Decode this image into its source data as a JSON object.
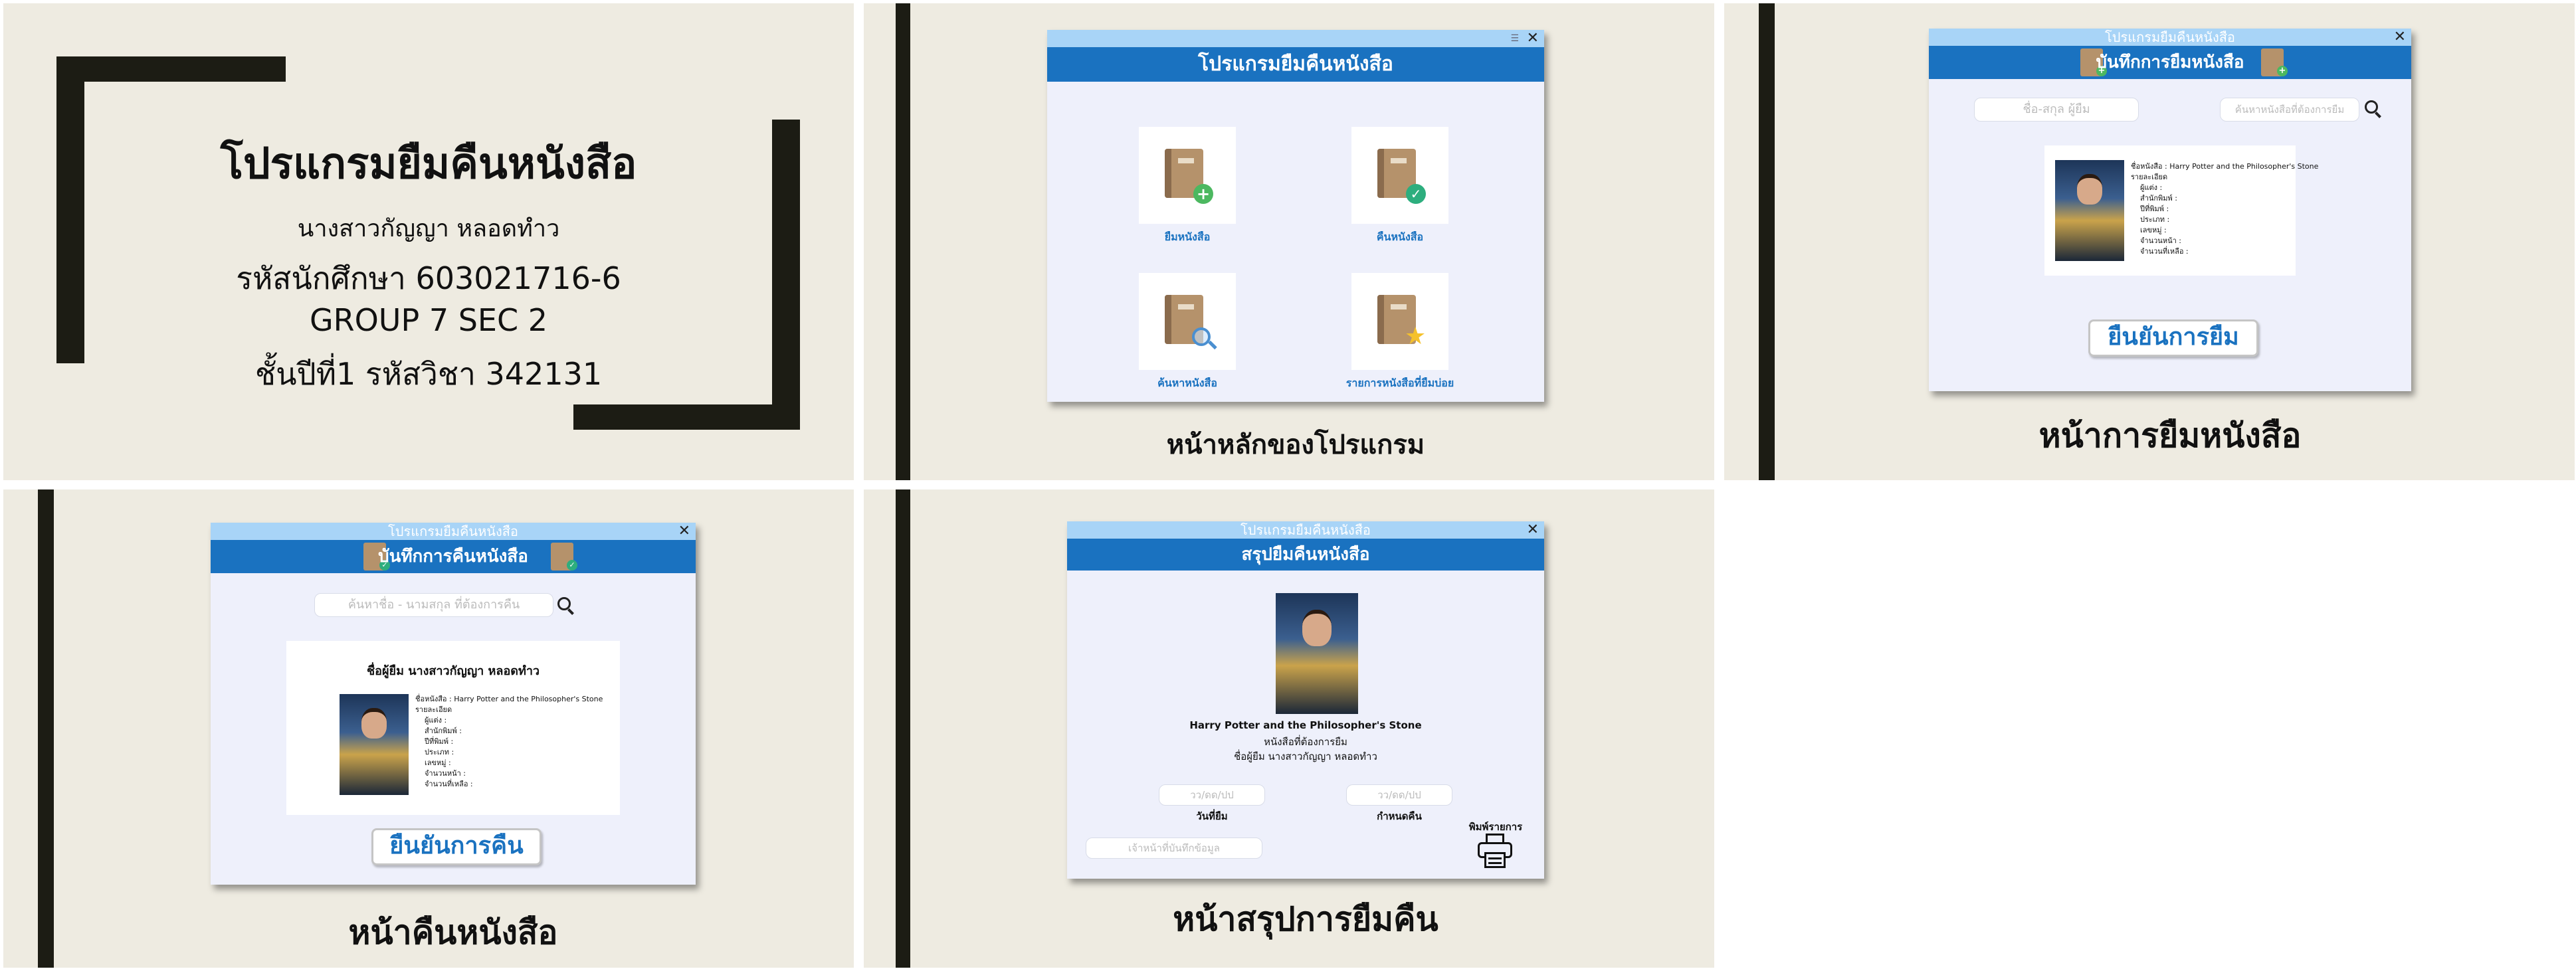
{
  "title_slide": {
    "title": "โปรแกรมยืมคืนหนังสือ",
    "name": "นางสาวกัญญา หลอดทำว",
    "student_id": "รหัสนักศึกษา 603021716-6",
    "group": "GROUP 7 SEC 2",
    "course": "ชั้นปีที่1 รหัสวิชา 342131"
  },
  "main_slide": {
    "window_title": "โปรแกรมยืมคืนหนังสือ",
    "tiles": [
      {
        "label": "ยืมหนังสือ",
        "icon": "book-add-icon"
      },
      {
        "label": "คืนหนังสือ",
        "icon": "book-check-icon"
      },
      {
        "label": "ค้นหาหนังสือ",
        "icon": "book-search-icon"
      },
      {
        "label": "รายการหนังสือที่ยืมบ่อย",
        "icon": "book-star-icon"
      }
    ],
    "caption": "หน้าหลักของโปรแกรม"
  },
  "borrow_slide": {
    "app_title": "โปรแกรมยืมคืนหนังสือ",
    "header": "บันทึกการยืมหนังสือ",
    "name_placeholder": "ชื่อ-สกุล ผู้ยืม",
    "search_placeholder": "ค้นหาหนังสือที่ต้องการยืม",
    "book_info": "ชื่อหนังสือ : Harry Potter and the Philosopher's Stone\nรายละเอียด\n    ผู้แต่ง :\n    สำนักพิมพ์ :\n    ปีที่พิมพ์ :\n    ประเภท :\n    เลขหมู่ :\n    จำนวนหน้า :\n    จำนวนที่เหลือ :",
    "confirm_button": "ยืนยันการยืม",
    "caption": "หน้าการยืมหนังสือ"
  },
  "return_slide": {
    "app_title": "โปรแกรมยืมคืนหนังสือ",
    "header": "บันทึกการคืนหนังสือ",
    "search_placeholder": "ค้นหาชื่อ - นามสกุล ที่ต้องการคืน",
    "borrower": "ชื่อผู้ยืม นางสาวกัญญา หลอดทำว",
    "book_info": "ชื่อหนังสือ : Harry Potter and the Philosopher's Stone\nรายละเอียด\n    ผู้แต่ง :\n    สำนักพิมพ์ :\n    ปีที่พิมพ์ :\n    ประเภท :\n    เลขหมู่ :\n    จำนวนหน้า :\n    จำนวนที่เหลือ :",
    "confirm_button": "ยืนยันการคืน",
    "caption": "หน้าคืนหนังสือ"
  },
  "summary_slide": {
    "app_title": "โปรแกรมยืมคืนหนังสือ",
    "header": "สรุปยืมคืนหนังสือ",
    "book_title": "Harry Potter and the Philosopher's Stone",
    "subtitle": "หนังสือที่ต้องการยืม",
    "borrower": "ชื่อผู้ยืม นางสาวกัญญา หลอดทำว",
    "date_placeholder": "วว/ดด/ปป",
    "borrow_date_label": "วันที่ยืม",
    "due_date_label": "กำหนดคืน",
    "staff_placeholder": "เจ้าหน้าที่บันทึกข้อมูล",
    "print_label": "พิมพ์รายการ",
    "caption": "หน้าสรุปการยืมคืน"
  },
  "colors": {
    "slide_bg": "#eeebe1",
    "accent_bar": "#1c1c14",
    "header_blue": "#1a72c0",
    "title_bar": "#a8d4f7",
    "window_bg": "#eef0fb"
  }
}
